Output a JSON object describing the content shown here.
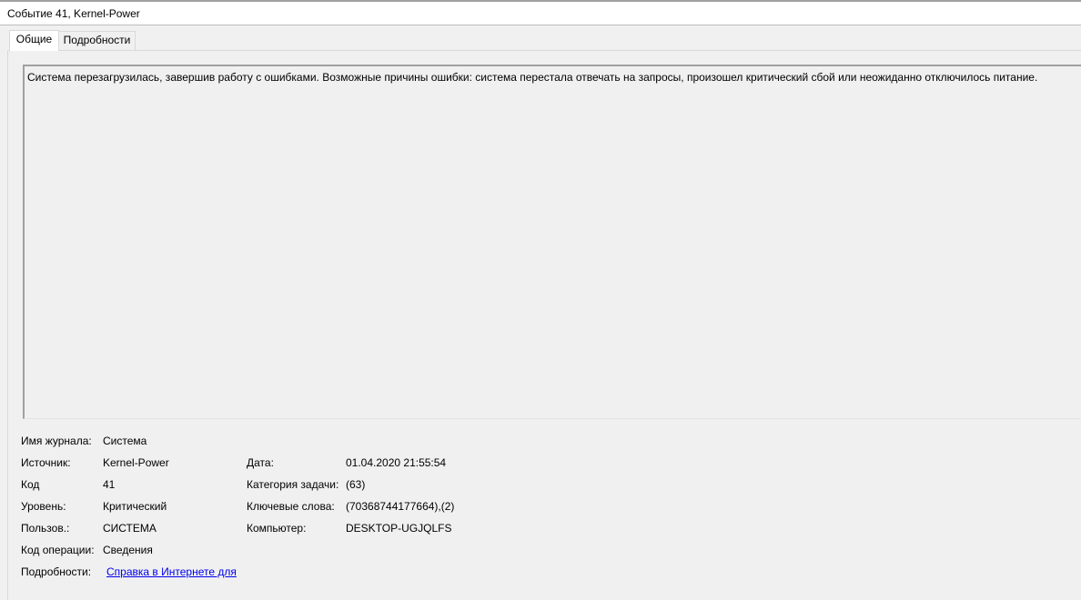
{
  "window": {
    "title": "Событие 41, Kernel-Power"
  },
  "tabs": [
    {
      "label": "Общие",
      "active": true
    },
    {
      "label": "Подробности",
      "active": false
    }
  ],
  "description": "Система перезагрузилась, завершив работу с ошибками. Возможные причины ошибки: система перестала отвечать на запросы, произошел критический сбой или неожиданно отключилось питание.",
  "fields": {
    "log_name": {
      "label": "Имя журнала:",
      "value": "Система"
    },
    "source": {
      "label": "Источник:",
      "value": "Kernel-Power"
    },
    "event_id": {
      "label": "Код",
      "value": "41"
    },
    "level": {
      "label": "Уровень:",
      "value": "Критический"
    },
    "user": {
      "label": "Пользов.:",
      "value": "СИСТЕМА"
    },
    "opcode": {
      "label": "Код операции:",
      "value": "Сведения"
    },
    "more_info": {
      "label": "Подробности:",
      "value": "Справка в Интернете для"
    },
    "logged": {
      "label": "Дата:",
      "value": "01.04.2020 21:55:54"
    },
    "task_category": {
      "label": "Категория задачи:",
      "value": "(63)"
    },
    "keywords": {
      "label": "Ключевые слова:",
      "value": "(70368744177664),(2)"
    },
    "computer": {
      "label": "Компьютер:",
      "value": "DESKTOP-UGJQLFS"
    }
  },
  "colors": {
    "background": "#f0f0f0",
    "link": "#0000ee",
    "title_bar": "#ffffff"
  }
}
